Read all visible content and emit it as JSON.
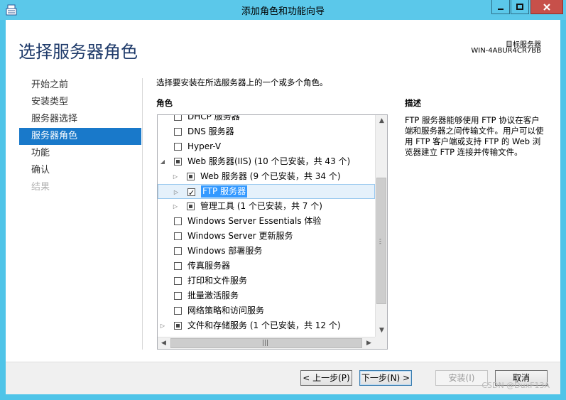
{
  "window": {
    "title": "添加角色和功能向导"
  },
  "header": {
    "page_title": "选择服务器角色",
    "target_label": "目标服务器",
    "target_name": "WIN-4ABUR4CR7BB"
  },
  "nav": {
    "items": [
      {
        "label": "开始之前",
        "state": "normal"
      },
      {
        "label": "安装类型",
        "state": "normal"
      },
      {
        "label": "服务器选择",
        "state": "normal"
      },
      {
        "label": "服务器角色",
        "state": "active"
      },
      {
        "label": "功能",
        "state": "normal"
      },
      {
        "label": "确认",
        "state": "normal"
      },
      {
        "label": "结果",
        "state": "disabled"
      }
    ]
  },
  "main": {
    "instruction": "选择要安装在所选服务器上的一个或多个角色。",
    "roles_header": "角色",
    "roles": [
      {
        "label": "DHCP 服务器",
        "check": "unchecked",
        "expander": "none",
        "indent": 0
      },
      {
        "label": "DNS 服务器",
        "check": "unchecked",
        "expander": "none",
        "indent": 0
      },
      {
        "label": "Hyper-V",
        "check": "unchecked",
        "expander": "none",
        "indent": 0
      },
      {
        "label": "Web 服务器(IIS) (10 个已安装，共 43 个)",
        "check": "partial",
        "expander": "expanded",
        "indent": 0
      },
      {
        "label": "Web 服务器 (9 个已安装，共 34 个)",
        "check": "partial",
        "expander": "collapsed",
        "indent": 1
      },
      {
        "label": "FTP 服务器",
        "check": "checked",
        "expander": "collapsed",
        "indent": 1,
        "selected": true
      },
      {
        "label": "管理工具 (1 个已安装，共 7 个)",
        "check": "partial",
        "expander": "collapsed",
        "indent": 1
      },
      {
        "label": "Windows Server Essentials 体验",
        "check": "unchecked",
        "expander": "none",
        "indent": 0
      },
      {
        "label": "Windows Server 更新服务",
        "check": "unchecked",
        "expander": "none",
        "indent": 0
      },
      {
        "label": "Windows 部署服务",
        "check": "unchecked",
        "expander": "none",
        "indent": 0
      },
      {
        "label": "传真服务器",
        "check": "unchecked",
        "expander": "none",
        "indent": 0
      },
      {
        "label": "打印和文件服务",
        "check": "unchecked",
        "expander": "none",
        "indent": 0
      },
      {
        "label": "批量激活服务",
        "check": "unchecked",
        "expander": "none",
        "indent": 0
      },
      {
        "label": "网络策略和访问服务",
        "check": "unchecked",
        "expander": "none",
        "indent": 0
      },
      {
        "label": "文件和存储服务 (1 个已安装，共 12 个)",
        "check": "partial",
        "expander": "collapsed",
        "indent": 0
      }
    ],
    "description_header": "描述",
    "description": "FTP 服务器能够使用 FTP 协议在客户端和服务器之间传输文件。用户可以使用 FTP 客户端或支持 FTP 的 Web 浏览器建立 FTP 连接并传输文件。"
  },
  "footer": {
    "prev": "< 上一步(P)",
    "next": "下一步(N) >",
    "install": "安装(I)",
    "cancel": "取消"
  },
  "watermark": "CSDN @DuxF13A",
  "colors": {
    "titlebar": "#5bc8ea",
    "accent": "#1979ca",
    "close": "#c7504a"
  }
}
